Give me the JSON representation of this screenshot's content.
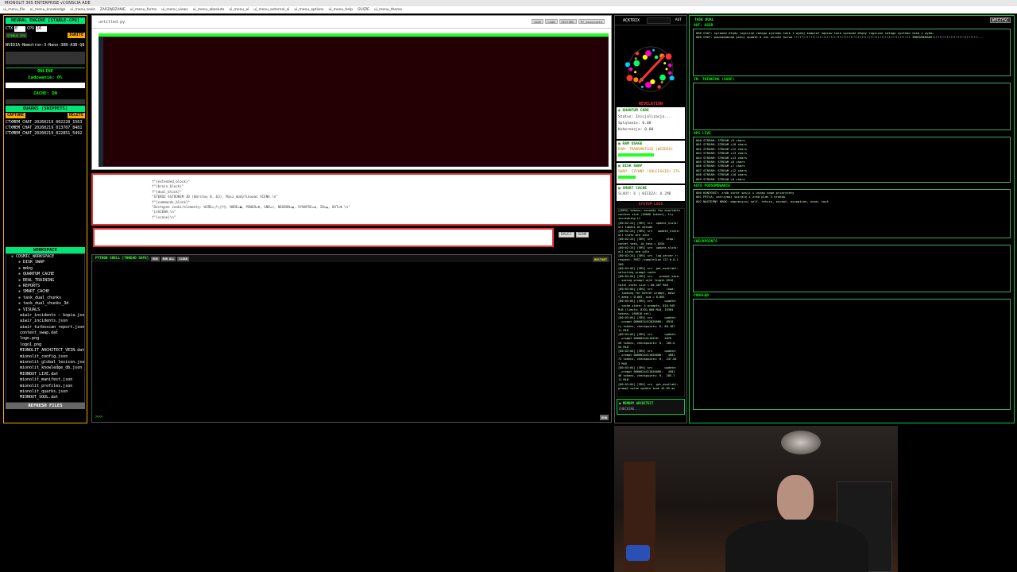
{
  "window": {
    "title": "MIONOLIT 365 ENTERPRISE vCONSCIA ADE"
  },
  "menu": {
    "items": [
      "ui_menu_file",
      "ui_menu_knowledge",
      "ui_menu_tools",
      "ZARZĄDZANIE",
      "ui_menu_forms",
      "ui_menu_views",
      "ui_menu_absolute",
      "ui_menu_ai",
      "ui_menu_external_ai",
      "ui_menu_options",
      "ui_menu_help",
      "GUIZIE",
      "ui_menu_theme"
    ]
  },
  "left": {
    "engine_header": "NEURAL ENGINE [STABLE-CPU]",
    "ctx_label": "CTX",
    "ctx_value": "0",
    "cpu_label": "CPU",
    "cpu_value": "16",
    "stable_badge": "STABLE CPU",
    "ignite": "IGNITE",
    "model": "NVIDIA-Nemotron-3-Nano-30B-A3B-Q8",
    "online": "ONLINE",
    "loading": "Ładowanie: 0%",
    "cache": "CACHE: ON",
    "quarks_header": "QUARKS (SNIPPETS)",
    "capture": "CAPTURE",
    "delete": "DELETE",
    "quarks": [
      "CTXMEM_CHAT_20260219_002220_1563",
      "CTXMEM_CHAT_20260219_013707_8481",
      "CTXMEM_CHAT_20260219_022851_5492"
    ],
    "workspace_header": "WORKSPACE",
    "tree": [
      "COSMIC_WORKSPACE",
      "DISK_SWAP",
      "mdzg",
      "QUANTUM_CACHE",
      "REAL_TRAINING",
      "REPORTS",
      "SMART_CACHE",
      "task_dual_chunks",
      "task_dual_chunks_3d",
      "VISUALS",
      "aiwir_incidents — kopia.json",
      "aiwir_incidents.json",
      "aiwir_turboscan_report.json",
      "context_swap.dat",
      "logo.png",
      "logo1.png",
      "MIONOLIT_ARCHITECT_VEIN.dat",
      "mionolit_config.json",
      "mionolit_global_lexicon.json",
      "mionolit_knowledge_db.json",
      "MIONOUT_LIVE.dat",
      "mionolit_manifest.json",
      "mionolit_profiles.json",
      "mionolit_quarks.json",
      "MIONOUT_SOUL.dat"
    ],
    "refresh": "REFRESH FILES"
  },
  "editor": {
    "filename": "untitled.py",
    "buttons": [
      "SAVE",
      "LOAD",
      "RESTORE",
      "PY_associate"
    ]
  },
  "prompt": {
    "lines": [
      "f\"{extended_block}\"",
      "f\"{brain_block}\"",
      "f\"{dual_block}\"",
      "\"STEROZ SSTOUKEM 3D (Warstwy 0..63). Masz modyfikować SCENE.\\n\"",
      "f\"{commands_block}\"",
      "\"Dostępne znaki/elementy: WIRE=┌┴┐┤┴┼, NODE=●, POWER=▼, GND=▽, NEURON=◉, SYNAPSE=◆, IN=▲, OUT=▼.\\n\"",
      "\"inSCENA:\\n\"",
      "f\"{scene}\\n\""
    ]
  },
  "input": {
    "dalej": "DALEJ",
    "send": "SEND"
  },
  "shell": {
    "title": "PYTHON SHELL [THREAD SAFE]",
    "buttons": [
      "RUN",
      "RUN ALL",
      "CLEAR"
    ],
    "restart": "RESTART",
    "prompt": ">>>",
    "enter": "RUN"
  },
  "mid": {
    "acktrix": "ACKTRIX",
    "aut": "AUT",
    "revelation": "REVELATION",
    "quantum_header": "QUANTUM CORE",
    "status": "Status: Inicjalizacja...",
    "splatanie": "Splątanie: 0.00",
    "koherencja": "Koherencja: 0.00",
    "ram_header": "RAM USAGE",
    "ram_status": "RAM: TRANSMUTUJĘ (WIEDZA)",
    "disk_header": "DISK SWAP",
    "disk_status": "SWAP: CZYWNY (SOLFEGGIO) 27%",
    "smart_header": "SMART CACHE",
    "smart_status": "ŚLADY: 6 | WIEDZA: 0.2MB",
    "logs_header": "SYSTEM LOGS",
    "logs": [
      "[INFO] tokens: exceeds the available",
      "context size (16000 tokens), try",
      "increasing it",
      "[00:02:24] [SRV] srv  update_slots:",
      "all tokens at decode",
      "[00:02:24] [SRV] srv   update_slots:",
      "all slots are idle",
      "[00:02:24] [SRV] srv        stop:",
      "cancel task, id_task = 8254",
      "[00:02:24] [SRV] srv  update_slots:",
      "all slots are idle",
      "[00:02:24] [SRV] srv  log_server_r:",
      "request: POST /completion 127.0.0.1",
      "200",
      "[00:03:04] [SRV] srv  get_availabl:",
      "selecting prompt cache",
      "[00:03:04] [SRV] srv    prompt_save:",
      "- saving prompt with length 6916,",
      "total state size = 60.487 MiB",
      "[00:03:04] [SRV] srv        load:",
      "- looking for better prompt, base",
      "f_keep = 0.003, sim = 0.003",
      "[00:03:04] [SRV] srv       update:",
      "- cache state: 4 prompts, 810.949",
      "MiB (limits: 8192.000 MiB, 16384",
      "tokens, 160816 est)",
      "[00:03:04] [SRV] srv       update:",
      "- prompt 0000024412020080:  6916",
      "ry tokens, checkpoints: 0, 60.487",
      "11 MiB",
      "[00:03:04] [SRV] srv       update:",
      "- prompt 00000244110420:   4876",
      "20 tokens, checkpoints: 0,  285.0",
      "54 MiB",
      "[00:03:04] [SRV] srv       update:",
      "- prompt 0000024411020000:   4901",
      "73 tokens, checkpoints: 0,  247.84",
      "3 MiB",
      "[00:03:04] [SRV] srv       update:",
      "- prompt 0000024411020000:   4901",
      "46 tokens, checkpoints: 0,  285.7",
      "11 MiB",
      "[00:03:04] [SRV] srv  get_availabl:",
      "prompt cache update took 44.69 ms"
    ],
    "memory_header": "MEMORY ARCHITECT",
    "memory_status": "CHECKING..."
  },
  "right": {
    "task_header": "TASK DUAL",
    "wyczysc": "WYCZYŚĆ",
    "out_user_label": "OUT: USER",
    "out_user": [
      "000 CHAT: sprawdź błędy logiczne całego systemu task 1 wydaj komplet napraw task sprawdź błędy logiczne całego systemu task 1 wyda…",
      "000 CHAT: powiadamiam pełny update a nie ucinki kurwa !!!!!!!!!!!!!!!!!!!!!!!!!!!!!!!!!!!!!!!!!!!!!!!!!!!!!!!!!!!!!!!! IMDIUREDAKO!!!!!!!!!!!!!!!!!!!!!!!!!..."
    ],
    "thinking_label": "IN: THINKING (GGUF)",
    "ops_label": "OPS LIVE",
    "ops": [
      "000 STREAM: STREAM +9 chars",
      "001 STREAM: STREAM +10 chars",
      "002 STREAM: STREAM +12 chars",
      "003 STREAM: STREAM +13 chars",
      "004 STREAM: STREAM +13 chars",
      "005 STREAM: STREAM +8 chars",
      "006 STREAM: STREAM +7 chars",
      "007 STREAM: STREAM +12 chars",
      "008 STREAM: STREAM +10 chars",
      "009 STREAM: STREAM +8 chars"
    ],
    "auto_label": "AUTO PODSUMOWANIE",
    "auto": [
      "000 KONTEKST: zrób skrót sesji i ustaw nowe priorytety",
      "001 PĘTLA: zatrzymaj spiralę i zrób plan 3 kroków",
      "002 NASTĘPNY KROK: doprecyzuj self, return, except, exception, none, text"
    ],
    "checkpoints_label": "CHECKPOINTS",
    "podglad_label": "PODGLĄD"
  },
  "colors": {
    "accent": "#00e676",
    "orange": "#ffa800",
    "editor_bg": "#240005"
  }
}
